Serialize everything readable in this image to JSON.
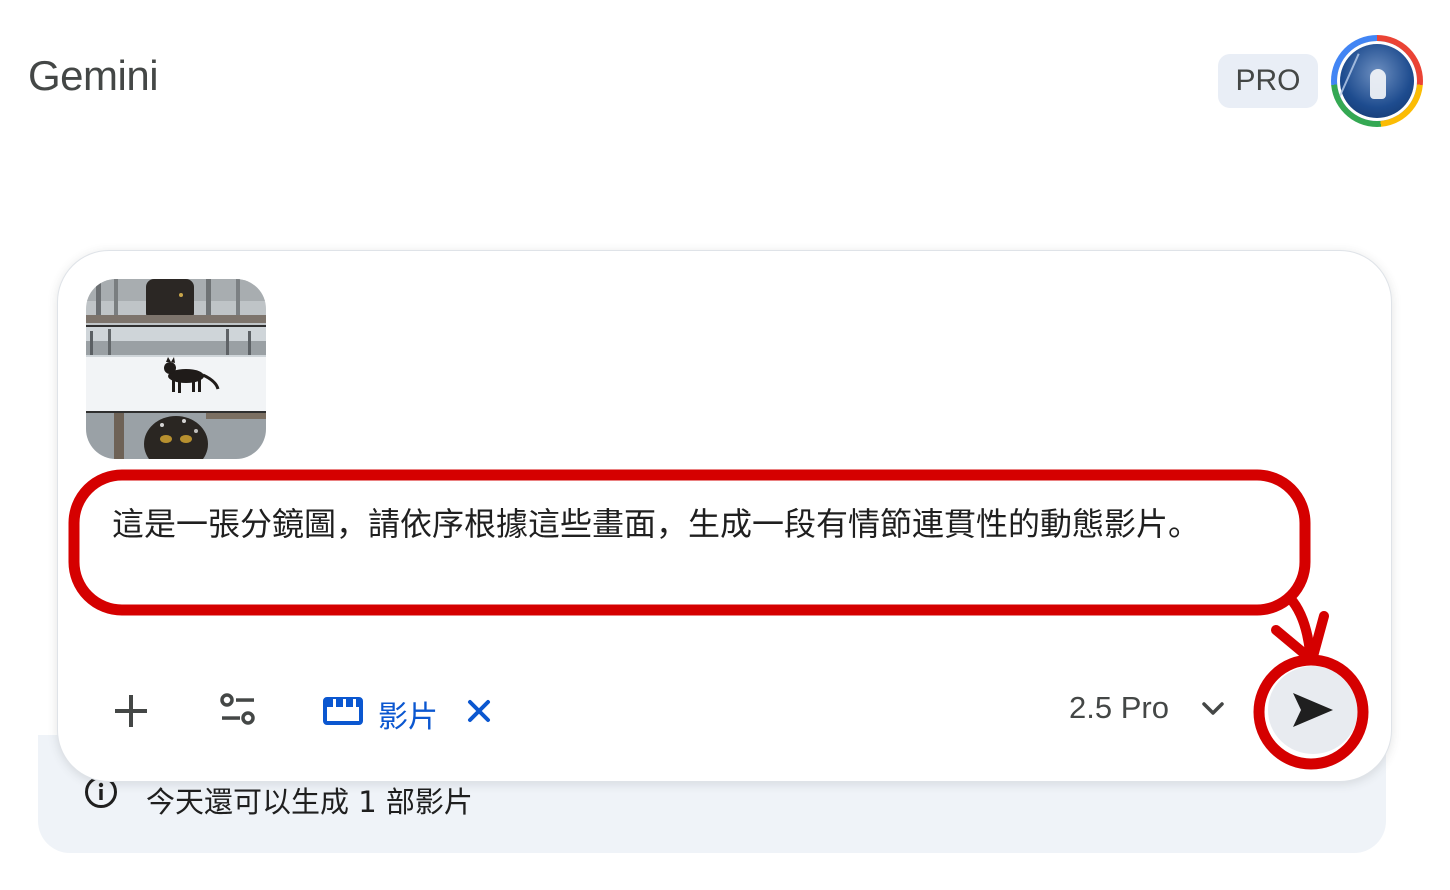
{
  "header": {
    "app_title": "Gemini",
    "plan_badge": "PRO",
    "avatar_icon": "account-avatar"
  },
  "composer": {
    "attachment_icon": "storyboard-image-thumbnail",
    "prompt_text": "這是一張分鏡圖，請依序根據這些畫面，生成一段有情節連貫性的動態影片。",
    "add_icon": "plus-icon",
    "tools_icon": "tune-icon",
    "video_chip": {
      "icon": "clapperboard-icon",
      "label": "影片",
      "remove_icon": "close-icon"
    },
    "model_selector": {
      "label": "2.5 Pro",
      "icon": "chevron-down-icon"
    },
    "send_icon": "send-icon"
  },
  "quota": {
    "icon": "info-icon",
    "text": "今天還可以生成 1 部影片"
  },
  "annotations": {
    "color": "#d50000",
    "highlight_target": "prompt-text",
    "arrow_target": "send-button"
  }
}
